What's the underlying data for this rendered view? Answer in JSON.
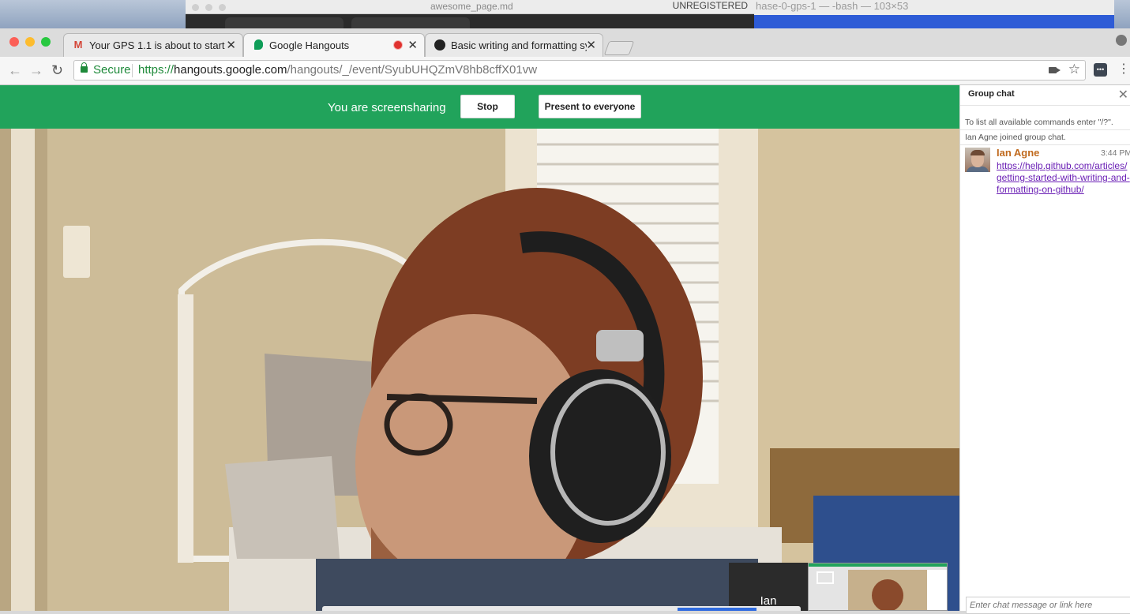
{
  "background_windows": {
    "editor": {
      "filename": "awesome_page.md",
      "status": "UNREGISTERED"
    },
    "terminal": {
      "title": "hase-0-gps-1 — -bash — 103×53"
    }
  },
  "browser": {
    "tabs": [
      {
        "title": "Your GPS 1.1 is about to start!",
        "favicon": "gmail-icon",
        "active": false
      },
      {
        "title": "Google Hangouts",
        "favicon": "hangouts-icon",
        "active": true,
        "recording": true
      },
      {
        "title": "Basic writing and formatting sy",
        "favicon": "github-icon",
        "active": false
      }
    ],
    "address_bar": {
      "secure_label": "Secure",
      "scheme": "https://",
      "host": "hangouts.google.com",
      "path": "/hangouts/_/event/SyubUHQZmV8hb8cffX01vw"
    }
  },
  "hangout": {
    "share_bar": {
      "status": "You are screensharing",
      "stop_label": "Stop",
      "present_label": "Present to everyone",
      "color": "#21a35b"
    },
    "participant_name": "Ian"
  },
  "chat": {
    "title": "Group chat",
    "hint": "To list all available commands enter \"/?\".",
    "joined": "Ian Agne joined group chat.",
    "messages": [
      {
        "sender": "Ian Agne",
        "time": "3:44 PM",
        "link": "https://help.github.com/articles/getting-started-with-writing-and-formatting-on-github/"
      }
    ],
    "input_placeholder": "Enter chat message or link here",
    "sender_color": "#c06a1e",
    "link_color": "#6a1fb5"
  }
}
